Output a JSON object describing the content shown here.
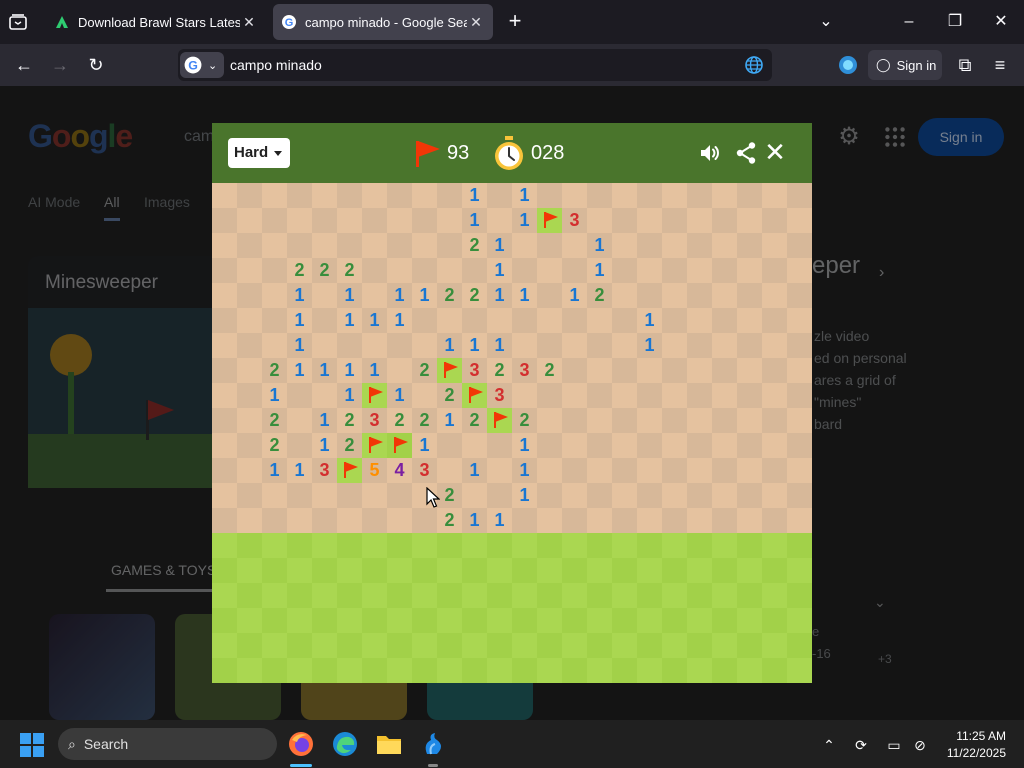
{
  "browser": {
    "tabs": [
      {
        "title": "Download Brawl Stars Latest Ve",
        "active": false
      },
      {
        "title": "campo minado - Google Search",
        "active": true
      }
    ],
    "url": "campo minado",
    "sign_in": "Sign in"
  },
  "google": {
    "logo": "Google",
    "query_fragment": "cam",
    "tabs": [
      "AI Mode",
      "All",
      "Images"
    ],
    "card_title": "Minesweeper",
    "games_label": "GAMES & TOYS",
    "sign_in": "Sign in",
    "right_heading": "eper",
    "right_lines": [
      "zle video",
      "ed on personal",
      "ares a grid of",
      "\"mines\"",
      "bard"
    ],
    "right_bottom": [
      "e",
      "-16",
      "+3"
    ]
  },
  "game": {
    "difficulty": "Hard",
    "flags_remaining": "93",
    "timer": "028",
    "colors": {
      "header": "#4a752c",
      "grass_light": "#aad751",
      "grass_dark": "#a2d149",
      "dirt_light": "#e5c29f",
      "dirt_dark": "#d7b899",
      "flag": "#f23607",
      "n1": "#1976d2",
      "n2": "#388e3c",
      "n3": "#d32f2f",
      "n4": "#7b1fa2",
      "n5": "#ff8f00"
    },
    "revealed": [
      "..........1.1...........",
      "..........1.1F3.........",
      "..........21...1........",
      "...222.....1...1........",
      "...1.1.112211.12........",
      "...1.111.........1......",
      "...1.....111.....1......",
      "..21111.2F3232..........",
      "..1..1F1.2F3............",
      "..2.1232212F2...........",
      "..2.12FF1...1...........",
      "..113F543.1.1...........",
      ".........2..1...........",
      ".........211............"
    ]
  },
  "taskbar": {
    "search": "Search",
    "time": "11:25 AM",
    "date": "11/22/2025"
  }
}
